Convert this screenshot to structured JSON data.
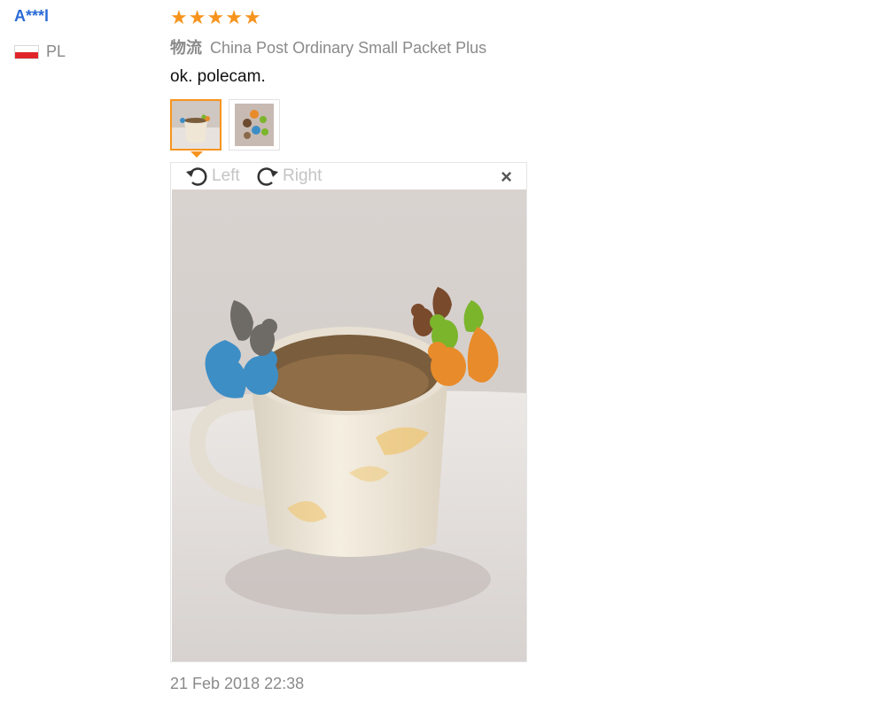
{
  "reviewer": {
    "name": "A***l",
    "country_code": "PL",
    "flag_icon": "poland-flag-icon"
  },
  "rating": {
    "value": 5,
    "max": 5,
    "star_icon": "star-icon",
    "color": "#f7941e"
  },
  "logistics": {
    "label": "物流",
    "carrier": "China Post Ordinary Small Packet Plus"
  },
  "review": {
    "text": "ok. polecam.",
    "date": "21 Feb 2018 22:38"
  },
  "images": {
    "selected_index": 0,
    "thumbnails": [
      "review-photo-mug-squirrels",
      "review-photo-squirrels-group"
    ]
  },
  "viewer": {
    "rotate_left_label": "Left",
    "rotate_right_label": "Right",
    "close_label": "×"
  },
  "colors": {
    "accent": "#f7941e",
    "link": "#2a6bd6",
    "muted": "#8a8a8a"
  }
}
